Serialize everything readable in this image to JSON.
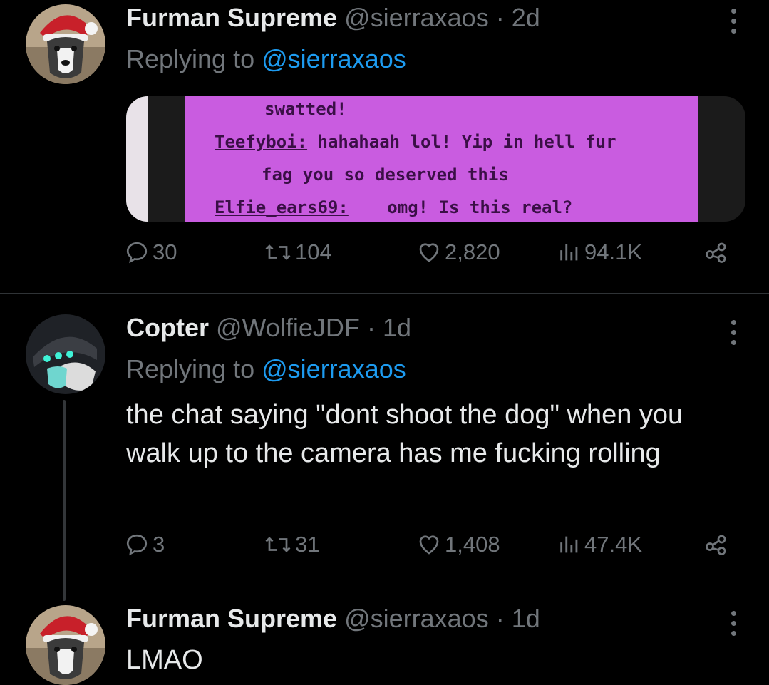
{
  "tweets": [
    {
      "name": "Furman Supreme",
      "handle": "@sierraxaos",
      "sep": "·",
      "time": "2d",
      "replying_prefix": "Replying to",
      "replying_to": "@sierraxaos",
      "media_lines": {
        "l1": "swatted!",
        "l2_user": "Teefyboi:",
        "l2_text": "hahahaah lol! Yip in hell fur",
        "l3": "fag you so deserved this",
        "l4_user": "Elfie_ears69:",
        "l4_text": "omg! Is this real?"
      },
      "stats": {
        "replies": "30",
        "retweets": "104",
        "likes": "2,820",
        "views": "94.1K"
      }
    },
    {
      "name": "Copter",
      "handle": "@WolfieJDF",
      "sep": "·",
      "time": "1d",
      "replying_prefix": "Replying to",
      "replying_to": "@sierraxaos",
      "text": "the chat saying \"dont shoot the dog\" when you walk up to the camera has me fucking rolling",
      "stats": {
        "replies": "3",
        "retweets": "31",
        "likes": "1,408",
        "views": "47.4K"
      }
    },
    {
      "name": "Furman Supreme",
      "handle": "@sierraxaos",
      "sep": "·",
      "time": "1d",
      "text": "LMAO"
    }
  ],
  "colors": {
    "background": "#000000",
    "text": "#e7e9ea",
    "muted": "#71767b",
    "link": "#1d9bf0",
    "divider": "#2f3336"
  },
  "icons": [
    "reply-icon",
    "retweet-icon",
    "like-icon",
    "views-icon",
    "share-icon",
    "more-icon"
  ]
}
